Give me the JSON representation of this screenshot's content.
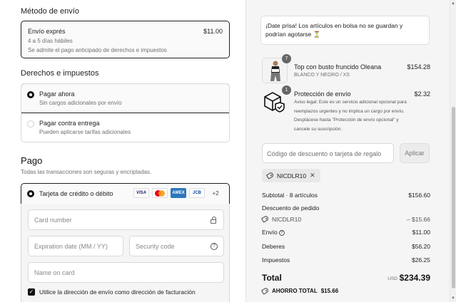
{
  "shipping": {
    "title": "Método de envío",
    "option_name": "Envío exprés",
    "option_price": "$11.00",
    "option_days": "4 a 5 días hábiles",
    "option_note": "Se admite el pago anticipado de derechos e impuestos"
  },
  "duties": {
    "title": "Derechos e impuestos",
    "options": [
      {
        "label": "Pagar ahora",
        "sub": "Sin cargos adicionales por envío",
        "selected": true
      },
      {
        "label": "Pagar contra entrega",
        "sub": "Pueden aplicarse tarifas adicionales",
        "selected": false
      }
    ]
  },
  "payment": {
    "title": "Pago",
    "subtitle": "Todas las transacciones son seguras y encriptadas.",
    "card_option_label": "Tarjeta de crédito o débito",
    "logos": [
      "VISA",
      "mastercard",
      "AMEX",
      "JCB"
    ],
    "more_logos": "+2",
    "card_number_placeholder": "Card number",
    "expiration_placeholder": "Expiration date (MM / YY)",
    "security_placeholder": "Security code",
    "name_placeholder": "Name on card",
    "billing_same_label": "Utilice la dirección de envío como dirección de facturación",
    "billing_same_checked": true
  },
  "summary": {
    "notice": "¡Date prisa! Los artículos en bolsa no se guardan y podrían agotarse ⏳",
    "items": [
      {
        "name": "Top con busto fruncido Oleana",
        "variant": "BLANCO Y NEGRO / XS",
        "price": "$154.28",
        "qty": "7",
        "icon": "product-photo"
      },
      {
        "name": "Protección de envío",
        "description": "Aviso legal: Este es un servicio adicional opcional para reemplazos urgentes y no implica un cargo por envío. Desplácese hasta \"Protección de envío opcional\" y cancele su suscripción.",
        "price": "$2.32",
        "qty": "1",
        "icon": "package-shield-icon"
      }
    ],
    "discount_placeholder": "Código de descuento o tarjeta de regalo",
    "apply_label": "Aplicar",
    "applied_code": "NICDLR10",
    "subtotal_label": "Subtotal · 8 artículos",
    "subtotal_value": "$156.60",
    "order_discount_label": "Descuento de pedido",
    "discount_code": "NICDLR10",
    "discount_value": "– $15.66",
    "shipping_label": "Envío",
    "shipping_value": "$11.00",
    "duties_label": "Deberes",
    "duties_value": "$56.20",
    "taxes_label": "Impuestos",
    "taxes_value": "$26.25",
    "total_label": "Total",
    "currency": "USD",
    "total_value": "$234.39",
    "savings_label": "AHORRO TOTAL",
    "savings_value": "$15.66"
  }
}
